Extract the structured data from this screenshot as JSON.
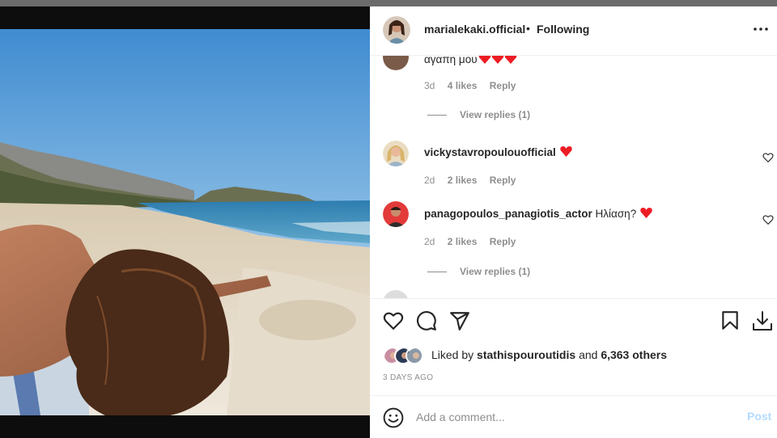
{
  "post": {
    "author": "marialekaki.official",
    "separator": "•",
    "follow_status": "Following"
  },
  "comments": [
    {
      "text": "αγαπη μου",
      "hearts": 3,
      "time": "3d",
      "likes": "4 likes",
      "reply": "Reply",
      "view_replies": "View replies (1)"
    },
    {
      "username": "vickystavropoulouofficial",
      "text": "",
      "hearts": 1,
      "time": "2d",
      "likes": "2 likes",
      "reply": "Reply"
    },
    {
      "username": "panagopoulos_panagiotis_actor",
      "text": "Ηλίαση?",
      "hearts": 1,
      "time": "2d",
      "likes": "2 likes",
      "reply": "Reply",
      "view_replies": "View replies (1)"
    }
  ],
  "likes": {
    "prefix": "Liked by",
    "user": "stathispouroutidis",
    "connector": "and",
    "others": "6,363 others"
  },
  "date": "3 DAYS AGO",
  "add_comment": {
    "placeholder": "Add a comment...",
    "post_label": "Post"
  },
  "icons": {
    "more": "more-options-icon",
    "heart": "heart-icon",
    "comment": "comment-icon",
    "share": "share-icon",
    "save": "bookmark-icon",
    "download": "download-icon",
    "emoji": "emoji-icon"
  },
  "colors": {
    "heart_red": "#ed1c24",
    "post_disabled": "#b3dbff",
    "meta_gray": "#8e8e8e",
    "text": "#262626"
  }
}
